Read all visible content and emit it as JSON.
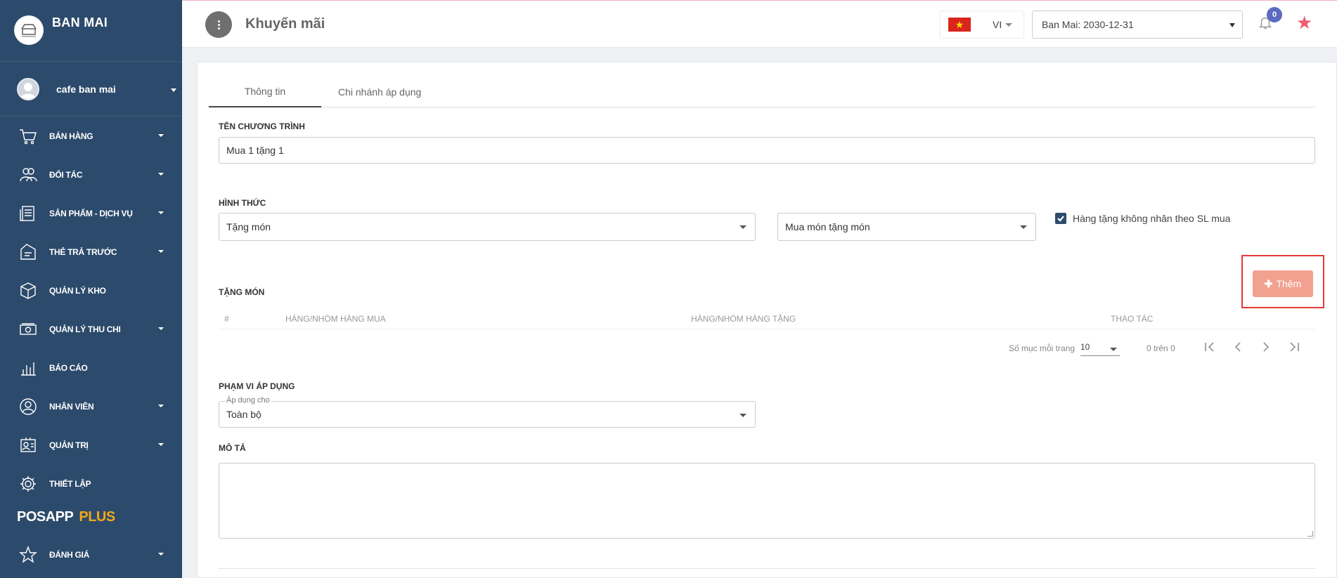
{
  "brand": {
    "name": "BAN MAI",
    "logo_icon": "store-logo-icon"
  },
  "user": {
    "name": "cafe ban mai"
  },
  "sidebar": {
    "items": [
      {
        "label": "BÁN HÀNG",
        "icon": "cart-icon",
        "has_caret": true
      },
      {
        "label": "ĐỐI TÁC",
        "icon": "partners-icon",
        "has_caret": true
      },
      {
        "label": "SẢN PHẨM - DỊCH VỤ",
        "icon": "products-icon",
        "has_caret": true
      },
      {
        "label": "THẺ TRẢ TRƯỚC",
        "icon": "prepaid-card-icon",
        "has_caret": true
      },
      {
        "label": "QUẢN LÝ KHO",
        "icon": "box-icon",
        "has_caret": false
      },
      {
        "label": "QUẢN LÝ THU CHI",
        "icon": "cash-icon",
        "has_caret": true
      },
      {
        "label": "BÁO CÁO",
        "icon": "bar-chart-icon",
        "has_caret": false
      },
      {
        "label": "NHÂN VIÊN",
        "icon": "employee-icon",
        "has_caret": true
      },
      {
        "label": "QUẢN TRỊ",
        "icon": "admin-icon",
        "has_caret": true
      },
      {
        "label": "THIẾT LẬP",
        "icon": "gear-icon",
        "has_caret": false
      }
    ],
    "posapp": {
      "main": "POSAPP",
      "plus": "PLUS"
    },
    "rating": {
      "label": "ĐÁNH GIÁ",
      "icon": "star-outline-icon"
    }
  },
  "header": {
    "title": "Khuyến mãi",
    "lang": "VI",
    "branch": "Ban Mai: 2030-12-31",
    "notifications": "0",
    "colors": {
      "accent": "#f05a6f",
      "badge": "#5c6bc0"
    }
  },
  "tabs": [
    {
      "label": "Thông tin"
    },
    {
      "label": "Chi nhánh áp dụng"
    }
  ],
  "form": {
    "program_name_label": "TÊN CHƯƠNG TRÌNH",
    "program_name_value": "Mua 1 tặng 1",
    "type_label": "HÌNH THỨC",
    "type_value": "Tặng món",
    "subtype_value": "Mua món tặng món",
    "checkbox_label": "Hàng tặng không nhân theo SL mua",
    "checkbox_checked": true,
    "add_button": "Thêm",
    "gift_section_label": "TẶNG MÓN",
    "table_headers": [
      "#",
      "HÀNG/NHÓM HÀNG MUA",
      "HÀNG/NHÓM HÀNG TẶNG",
      "THAO TÁC"
    ],
    "pager": {
      "per_page_label": "Số mục mỗi trang",
      "per_page_value": "10",
      "range": "0 trên 0"
    },
    "scope_label": "PHẠM VI ÁP DỤNG",
    "scope_field_label": "Áp dụng cho",
    "scope_value": "Toàn bộ",
    "description_label": "MÔ TẢ",
    "description_value": ""
  }
}
